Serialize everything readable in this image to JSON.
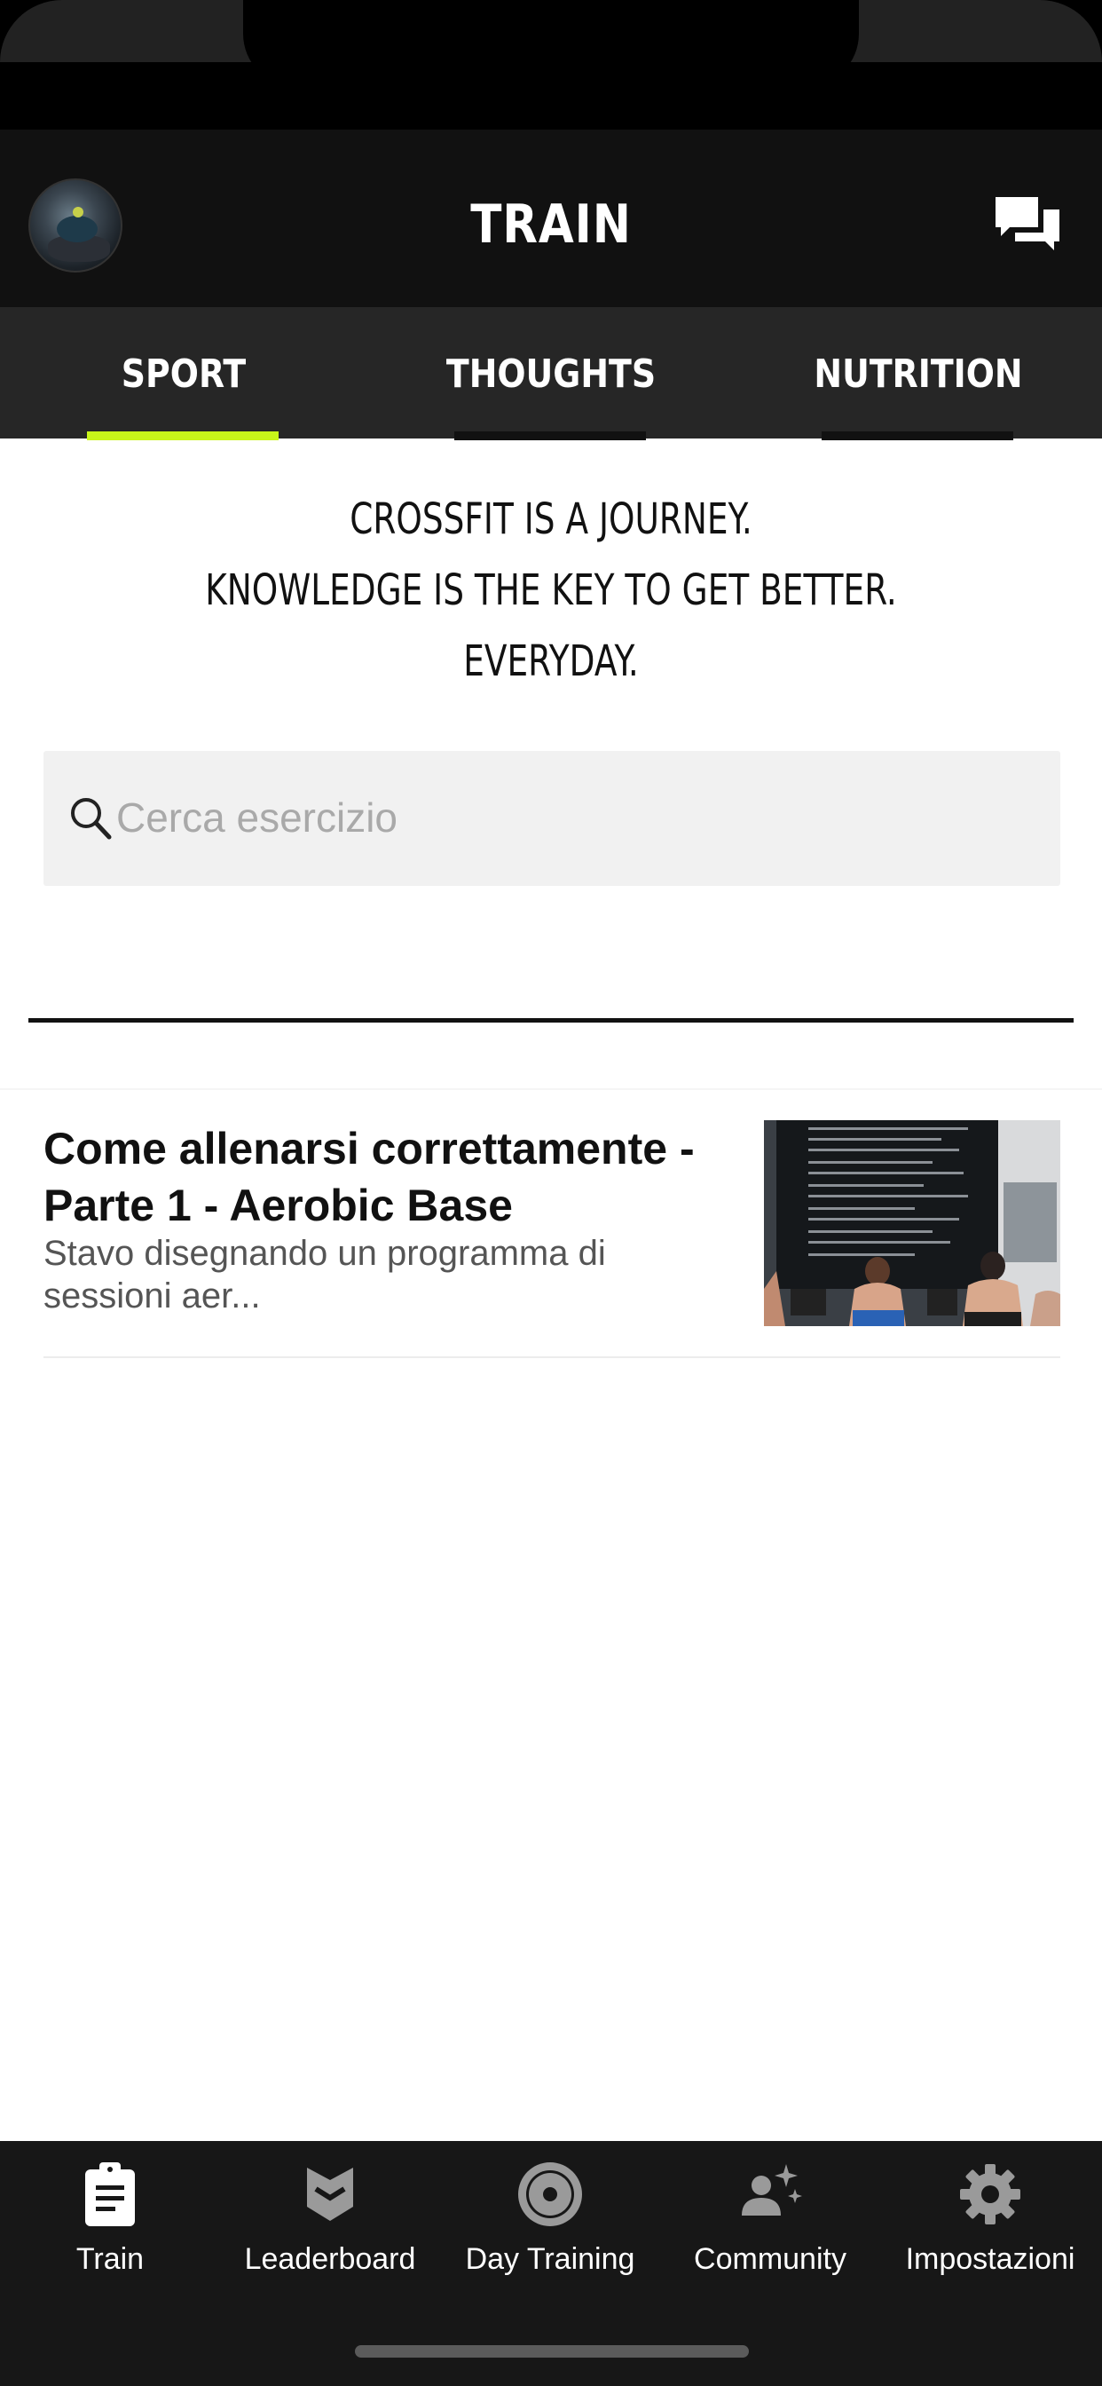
{
  "header": {
    "title": "TRAIN",
    "avatar_icon": "user-avatar",
    "chat_icon": "chat-bubbles-icon"
  },
  "tabs": [
    {
      "label": "SPORT",
      "active": true
    },
    {
      "label": "THOUGHTS",
      "active": false
    },
    {
      "label": "NUTRITION",
      "active": false
    }
  ],
  "tagline": {
    "line1": "CROSSFIT IS A JOURNEY.",
    "line2": "KNOWLEDGE IS THE KEY TO GET BETTER.",
    "line3": "EVERYDAY."
  },
  "search": {
    "placeholder": "Cerca esercizio",
    "value": ""
  },
  "articles": [
    {
      "title": "Come allenarsi correttamente - Parte 1 - Aerobic Base",
      "excerpt": "Stavo disegnando un programma di sessioni aer..."
    }
  ],
  "bottom_nav": [
    {
      "label": "Train",
      "icon": "clipboard-icon"
    },
    {
      "label": "Leaderboard",
      "icon": "chevron-badge-icon"
    },
    {
      "label": "Day Training",
      "icon": "plate-target-icon"
    },
    {
      "label": "Community",
      "icon": "person-sparkle-icon"
    },
    {
      "label": "Impostazioni",
      "icon": "gear-icon"
    }
  ],
  "colors": {
    "accent": "#c8f51a",
    "header_bg": "#111111",
    "tabs_bg": "#262626",
    "nav_bg": "#171717"
  }
}
